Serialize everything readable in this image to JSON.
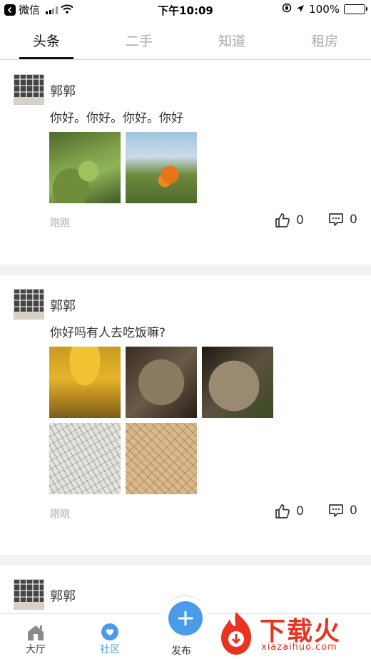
{
  "status_bar": {
    "back_app": "微信",
    "time": "下午10:09",
    "battery": "100%"
  },
  "tabs": [
    {
      "label": "头条",
      "active": true
    },
    {
      "label": "二手",
      "active": false
    },
    {
      "label": "知道",
      "active": false
    },
    {
      "label": "租房",
      "active": false
    }
  ],
  "posts": [
    {
      "username": "郭郭",
      "content": "你好。你好。你好。你好",
      "time": "刚刚",
      "likes": "0",
      "comments": "0",
      "images": [
        "leaf",
        "osmanthus-flower"
      ]
    },
    {
      "username": "郭郭",
      "content": "你好吗有人去吃饭嘛?",
      "time": "刚刚",
      "likes": "0",
      "comments": "0",
      "images": [
        "ginkgo-trees",
        "rock",
        "rock",
        "line-drawing",
        "line-drawing"
      ]
    },
    {
      "username": "郭郭"
    }
  ],
  "bottom_nav": {
    "hall": "大厅",
    "community": "社区",
    "publish": "发布"
  },
  "watermark": {
    "title": "下载火",
    "subtitle": "xiazaihuo.com"
  },
  "colors": {
    "accent": "#4a9ce8",
    "watermark": "#e8331f"
  }
}
